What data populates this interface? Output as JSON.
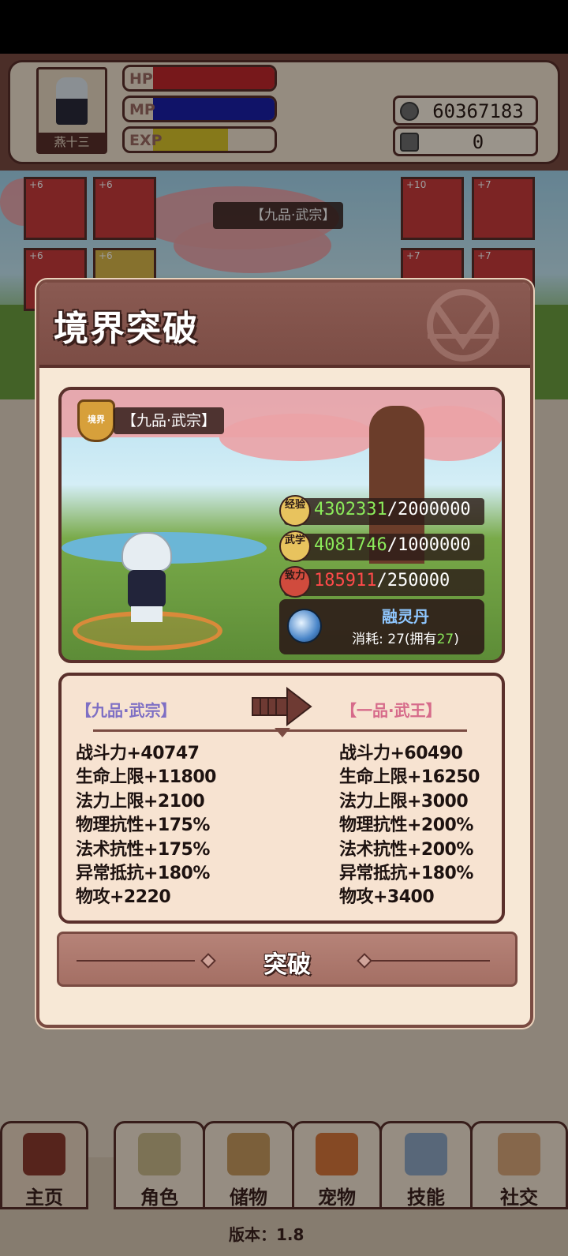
{
  "player": {
    "name": "燕十三",
    "bars": [
      {
        "label": "HP",
        "fill": 1.0,
        "color": "#c0282c"
      },
      {
        "label": "MP",
        "fill": 1.0,
        "color": "#1a1fa8"
      },
      {
        "label": "EXP",
        "fill": 0.62,
        "color": "#d8c42a"
      }
    ],
    "currency_1": "60367183",
    "currency_2": "0",
    "realm_label": "【九品·武宗】"
  },
  "equipment": {
    "left": [
      "+6",
      "+6",
      "+6",
      "+6"
    ],
    "right": [
      "+10",
      "+7",
      "+7",
      "+7"
    ]
  },
  "modal": {
    "title": "境界突破",
    "realm_badge": "境界",
    "realm_current": "【九品·武宗】",
    "stats": [
      {
        "icon_text": "经验",
        "value": "4302331",
        "max": "/2000000",
        "value_color": "#8bea5a",
        "icon_color": "#e8c35e"
      },
      {
        "icon_text": "武学",
        "value": "4081746",
        "max": "/1000000",
        "value_color": "#8bea5a",
        "icon_color": "#e8c35e"
      },
      {
        "icon_text": "致力",
        "value": "185911",
        "max": "/250000",
        "value_color": "#ff4a4a",
        "icon_color": "#d04b3d"
      }
    ],
    "pill": {
      "name": "融灵丹",
      "cost_prefix": "消耗: ",
      "cost_value": "27",
      "cost_mid": "(拥有",
      "owned": "27",
      "cost_suffix": ")"
    },
    "compare": {
      "from_label": "【九品·武宗】",
      "to_label": "【一品·武王】",
      "from_stats": [
        "战斗力+40747",
        "生命上限+11800",
        "法力上限+2100",
        "物理抗性+175%",
        "法术抗性+175%",
        "异常抵抗+180%",
        "物攻+2220"
      ],
      "to_stats": [
        "战斗力+60490",
        "生命上限+16250",
        "法力上限+3000",
        "物理抗性+200%",
        "法术抗性+200%",
        "异常抵抗+180%",
        "物攻+3400"
      ]
    },
    "breakthrough_button": "突破"
  },
  "nav": {
    "tabs": [
      {
        "label": "主页",
        "icon": "gate-icon",
        "color": "#8b3a2e"
      },
      {
        "label": "角色",
        "icon": "character-icon",
        "color": "#c9b98a"
      },
      {
        "label": "储物",
        "icon": "bag-icon",
        "color": "#c79a5e"
      },
      {
        "label": "宠物",
        "icon": "fox-icon",
        "color": "#d7763a"
      },
      {
        "label": "技能",
        "icon": "sword-icon",
        "color": "#8fa6c4"
      },
      {
        "label": "社交",
        "icon": "handshake-icon",
        "color": "#d9a67a"
      }
    ],
    "version": "版本：1.8"
  }
}
